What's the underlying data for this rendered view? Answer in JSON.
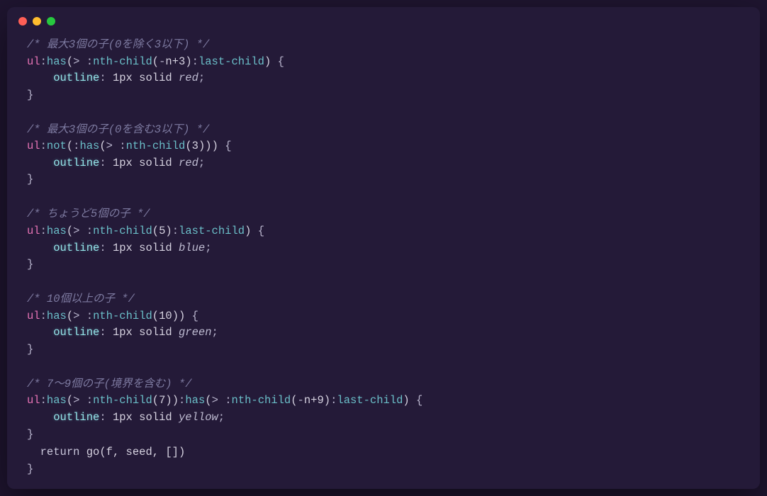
{
  "window": {
    "traffic": {
      "red": "#ff5f56",
      "yellow": "#ffbd2e",
      "green": "#27c93f"
    }
  },
  "code": {
    "blocks": [
      {
        "comment": "/* 最大3個の子(0を除く3以下) */",
        "selector": {
          "tag": "ul",
          "chain": ":has(> :nth-child(-n+3):last-child)"
        },
        "decl": {
          "property": "outline",
          "value_plain": "1px solid",
          "value_color": "red"
        }
      },
      {
        "comment": "/* 最大3個の子(0を含む3以下) */",
        "selector": {
          "tag": "ul",
          "chain": ":not(:has(> :nth-child(3)))"
        },
        "decl": {
          "property": "outline",
          "value_plain": "1px solid",
          "value_color": "red"
        }
      },
      {
        "comment": "/* ちょうど5個の子 */",
        "selector": {
          "tag": "ul",
          "chain": ":has(> :nth-child(5):last-child)"
        },
        "decl": {
          "property": "outline",
          "value_plain": "1px solid",
          "value_color": "blue"
        }
      },
      {
        "comment": "/* 10個以上の子 */",
        "selector": {
          "tag": "ul",
          "chain": ":has(> :nth-child(10))"
        },
        "decl": {
          "property": "outline",
          "value_plain": "1px solid",
          "value_color": "green"
        }
      },
      {
        "comment": "/* 7〜9個の子(境界を含む) */",
        "selector": {
          "tag": "ul",
          "chain": ":has(> :nth-child(7)):has(> :nth-child(-n+9):last-child)"
        },
        "decl": {
          "property": "outline",
          "value_plain": "1px solid",
          "value_color": "yellow"
        }
      }
    ],
    "trailing": {
      "return_kw": "return",
      "expr": "go(f, seed, [])"
    }
  }
}
